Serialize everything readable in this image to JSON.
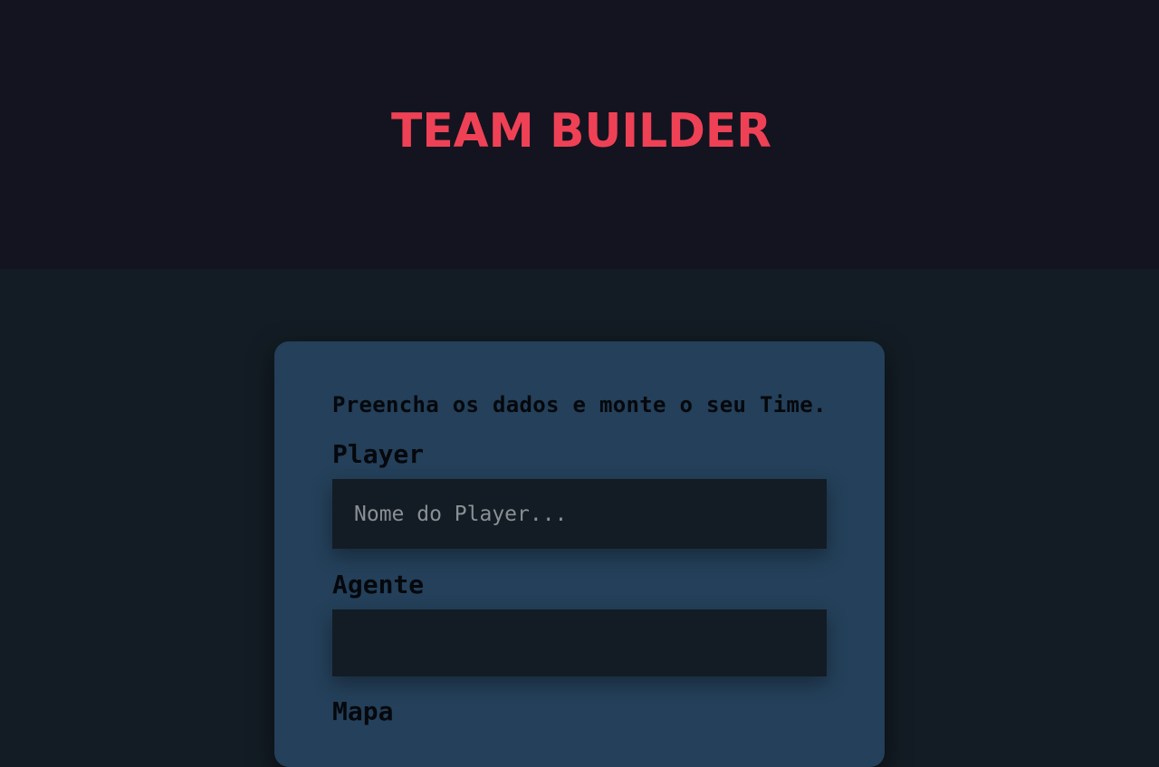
{
  "header": {
    "logo_text": "TEAM BUILDER",
    "logo_color": "#ef4155"
  },
  "form": {
    "intro": "Preencha os dados e monte o seu Time.",
    "player": {
      "label": "Player",
      "placeholder": "Nome do Player...",
      "value": ""
    },
    "agent": {
      "label": "Agente",
      "value": ""
    },
    "map": {
      "label": "Mapa"
    }
  },
  "colors": {
    "header_bg": "#141420",
    "page_bg": "#131c24",
    "card_bg": "#24405a",
    "field_bg": "#131c24",
    "accent": "#ef4155"
  }
}
